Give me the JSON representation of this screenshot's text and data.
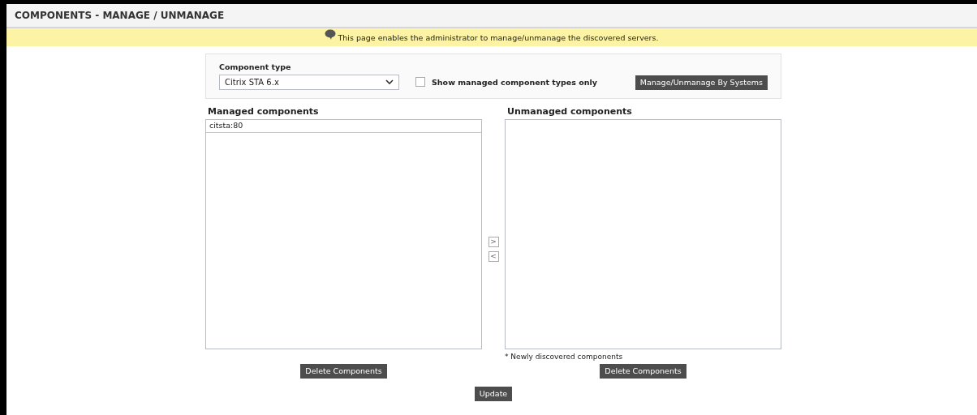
{
  "title": "COMPONENTS - MANAGE / UNMANAGE",
  "banner": "This page enables the administrator to manage/unmanage the discovered servers.",
  "component_type": {
    "label": "Component type",
    "value": "Citrix STA 6.x"
  },
  "show_managed_only": {
    "label": "Show managed component types only",
    "checked": false
  },
  "systems_button": "Manage/Unmanage By Systems",
  "managed": {
    "heading": "Managed components",
    "items": [
      "citsta:80"
    ],
    "delete_button": "Delete Components"
  },
  "move_buttons": [
    ">",
    "<"
  ],
  "unmanaged": {
    "heading": "Unmanaged components",
    "note": "* Newly discovered components",
    "delete_button": "Delete Components"
  },
  "update_button": "Update"
}
